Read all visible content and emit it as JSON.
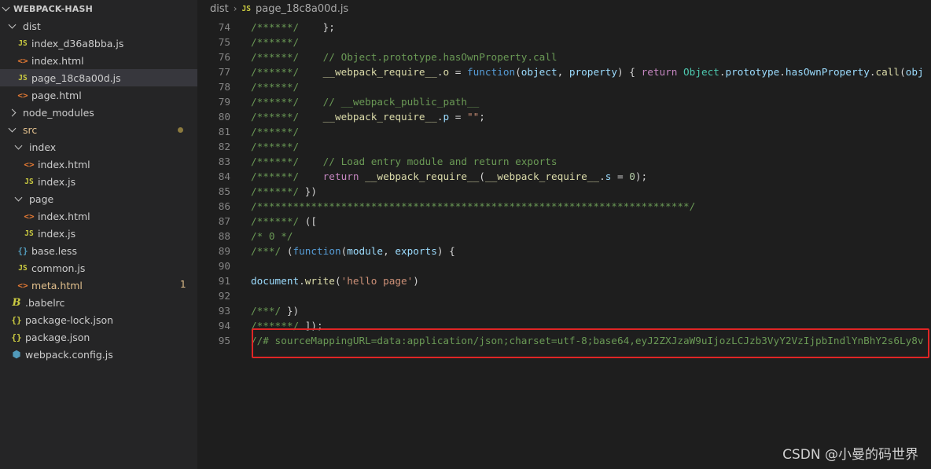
{
  "explorer": {
    "root_label": "WEBPACK-HASH",
    "items": [
      {
        "label": "dist",
        "type": "folder",
        "open": true
      },
      {
        "label": "index_d36a8bba.js",
        "type": "js"
      },
      {
        "label": "index.html",
        "type": "html"
      },
      {
        "label": "page_18c8a00d.js",
        "type": "js",
        "selected": true
      },
      {
        "label": "page.html",
        "type": "html"
      },
      {
        "label": "node_modules",
        "type": "folder",
        "open": false
      },
      {
        "label": "src",
        "type": "folder",
        "open": true,
        "modified": true
      },
      {
        "label": "index",
        "type": "folder",
        "open": true
      },
      {
        "label": "index.html",
        "type": "html"
      },
      {
        "label": "index.js",
        "type": "js"
      },
      {
        "label": "page",
        "type": "folder",
        "open": true
      },
      {
        "label": "index.html",
        "type": "html"
      },
      {
        "label": "index.js",
        "type": "js"
      },
      {
        "label": "base.less",
        "type": "less"
      },
      {
        "label": "common.js",
        "type": "js"
      },
      {
        "label": "meta.html",
        "type": "html",
        "modified": true,
        "badge": "1"
      },
      {
        "label": ".babelrc",
        "type": "babel"
      },
      {
        "label": "package-lock.json",
        "type": "json"
      },
      {
        "label": "package.json",
        "type": "json"
      },
      {
        "label": "webpack.config.js",
        "type": "webpack"
      }
    ]
  },
  "icons": {
    "js": "JS",
    "html": "<>",
    "less": "{}",
    "json": "{}",
    "babel": "B",
    "webpack": "⬢"
  },
  "breadcrumb": {
    "folder": "dist",
    "file_icon": "JS",
    "file": "page_18c8a00d.js"
  },
  "code_lines": [
    {
      "num": "74",
      "tokens": [
        [
          "c",
          "/******/"
        ],
        [
          "p",
          "    };"
        ]
      ]
    },
    {
      "num": "75",
      "tokens": [
        [
          "c",
          "/******/"
        ]
      ]
    },
    {
      "num": "76",
      "tokens": [
        [
          "c",
          "/******/"
        ],
        [
          "p",
          "    "
        ],
        [
          "c",
          "// Object.prototype.hasOwnProperty.call"
        ]
      ]
    },
    {
      "num": "77",
      "tokens": [
        [
          "c",
          "/******/"
        ],
        [
          "p",
          "    "
        ],
        [
          "f",
          "__webpack_require__"
        ],
        [
          "p",
          "."
        ],
        [
          "f",
          "o"
        ],
        [
          "p",
          " = "
        ],
        [
          "k",
          "function"
        ],
        [
          "p",
          "("
        ],
        [
          "v",
          "object"
        ],
        [
          "p",
          ", "
        ],
        [
          "v",
          "property"
        ],
        [
          "p",
          ") { "
        ],
        [
          "kc",
          "return"
        ],
        [
          "p",
          " "
        ],
        [
          "t",
          "Object"
        ],
        [
          "p",
          "."
        ],
        [
          "v",
          "prototype"
        ],
        [
          "p",
          "."
        ],
        [
          "v",
          "hasOwnProperty"
        ],
        [
          "p",
          "."
        ],
        [
          "f",
          "call"
        ],
        [
          "p",
          "("
        ],
        [
          "v",
          "obj"
        ]
      ]
    },
    {
      "num": "78",
      "tokens": [
        [
          "c",
          "/******/"
        ]
      ]
    },
    {
      "num": "79",
      "tokens": [
        [
          "c",
          "/******/"
        ],
        [
          "p",
          "    "
        ],
        [
          "c",
          "// __webpack_public_path__"
        ]
      ]
    },
    {
      "num": "80",
      "tokens": [
        [
          "c",
          "/******/"
        ],
        [
          "p",
          "    "
        ],
        [
          "f",
          "__webpack_require__"
        ],
        [
          "p",
          "."
        ],
        [
          "v",
          "p"
        ],
        [
          "p",
          " = "
        ],
        [
          "s",
          "\"\""
        ],
        [
          "p",
          ";"
        ]
      ]
    },
    {
      "num": "81",
      "tokens": [
        [
          "c",
          "/******/"
        ]
      ]
    },
    {
      "num": "82",
      "tokens": [
        [
          "c",
          "/******/"
        ]
      ]
    },
    {
      "num": "83",
      "tokens": [
        [
          "c",
          "/******/"
        ],
        [
          "p",
          "    "
        ],
        [
          "c",
          "// Load entry module and return exports"
        ]
      ]
    },
    {
      "num": "84",
      "tokens": [
        [
          "c",
          "/******/"
        ],
        [
          "p",
          "    "
        ],
        [
          "kc",
          "return"
        ],
        [
          "p",
          " "
        ],
        [
          "f",
          "__webpack_require__"
        ],
        [
          "p",
          "("
        ],
        [
          "f",
          "__webpack_require__"
        ],
        [
          "p",
          "."
        ],
        [
          "v",
          "s"
        ],
        [
          "p",
          " = "
        ],
        [
          "n",
          "0"
        ],
        [
          "p",
          ");"
        ]
      ]
    },
    {
      "num": "85",
      "tokens": [
        [
          "c",
          "/******/"
        ],
        [
          "p",
          " })"
        ]
      ]
    },
    {
      "num": "86",
      "tokens": [
        [
          "c",
          "/************************************************************************/"
        ]
      ]
    },
    {
      "num": "87",
      "tokens": [
        [
          "c",
          "/******/"
        ],
        [
          "p",
          " (["
        ]
      ]
    },
    {
      "num": "88",
      "tokens": [
        [
          "c",
          "/* 0 */"
        ]
      ]
    },
    {
      "num": "89",
      "tokens": [
        [
          "c",
          "/***/"
        ],
        [
          "p",
          " ("
        ],
        [
          "k",
          "function"
        ],
        [
          "p",
          "("
        ],
        [
          "v",
          "module"
        ],
        [
          "p",
          ", "
        ],
        [
          "v",
          "exports"
        ],
        [
          "p",
          ") {"
        ]
      ]
    },
    {
      "num": "90",
      "tokens": []
    },
    {
      "num": "91",
      "tokens": [
        [
          "v",
          "document"
        ],
        [
          "p",
          "."
        ],
        [
          "f",
          "write"
        ],
        [
          "p",
          "("
        ],
        [
          "s",
          "'hello page'"
        ],
        [
          "p",
          ")"
        ]
      ]
    },
    {
      "num": "92",
      "tokens": []
    },
    {
      "num": "93",
      "tokens": [
        [
          "c",
          "/***/"
        ],
        [
          "p",
          " })"
        ]
      ]
    },
    {
      "num": "94",
      "tokens": [
        [
          "c",
          "/******/"
        ],
        [
          "p",
          " ]);"
        ]
      ]
    },
    {
      "num": "95",
      "tokens": [
        [
          "c",
          "//# sourceMappingURL=data:application/json;charset=utf-8;base64,eyJ2ZXJzaW9uIjozLCJzb3VyY2VzIjpbIndlYnBhY2s6Ly8v"
        ]
      ]
    }
  ],
  "watermark": "CSDN @小曼的码世界"
}
